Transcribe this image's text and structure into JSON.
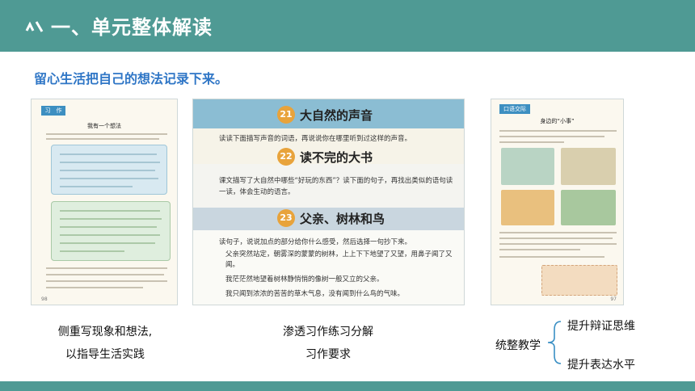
{
  "header": {
    "title": "一、单元整体解读"
  },
  "subtitle": "留心生活把自己的想法记录下来。",
  "panel1": {
    "tag": "习　作",
    "heading": "我有一个想法",
    "page_left": "98",
    "page_right": ""
  },
  "panel2": {
    "items": [
      {
        "num": "21",
        "title": "大自然的声音",
        "text": "读读下面描写声音的词语，再说说你在哪里听到过这样的声音。"
      },
      {
        "num": "22",
        "title": "读不完的大书",
        "text": "课文描写了大自然中哪些“好玩的东西”？读下面的句子，再找出类似的语句读一读，体会生动的语言。"
      },
      {
        "num": "23",
        "title": "父亲、树林和鸟",
        "text": "读句子，说说加点的部分给你什么感受，然后选择一句抄下来。"
      }
    ],
    "sentences": [
      "父亲突然站定，朝雾深的蒙蒙的树林，上上下下地望了又望，用鼻子闻了又闻。",
      "我茫茫然地望着树林静悄悄的像树一般又立的父亲。",
      "我只闻到浓浓的苦苦的草木气息，没有闻到什么鸟的气味。"
    ]
  },
  "panel3": {
    "tag": "口语交际",
    "heading": "身边的“小事”",
    "page_num": "97"
  },
  "captions": {
    "left_line1": "侧重写现象和想法,",
    "left_line2": "以指导生活实践",
    "mid_line1": "渗透习作练习分解",
    "mid_line2": "习作要求",
    "right_main": "统整教学",
    "right_top": "提升辩证思维",
    "right_bottom": "提升表达水平"
  },
  "colors": {
    "header": "#4f9a94",
    "subtitle": "#2f76c6"
  }
}
